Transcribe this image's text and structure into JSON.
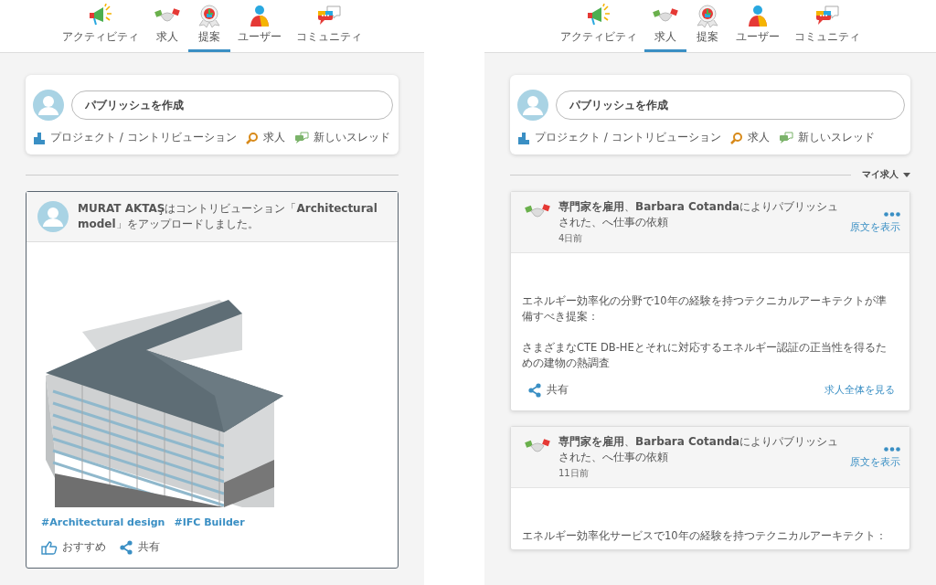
{
  "screens": [
    {
      "tabs": [
        {
          "label": "アクティビティ",
          "selected": false,
          "kind": "activity"
        },
        {
          "label": "求人",
          "selected": false,
          "kind": "jobs"
        },
        {
          "label": "提案",
          "selected": true,
          "kind": "proposals"
        },
        {
          "label": "ユーザー",
          "selected": false,
          "kind": "users"
        },
        {
          "label": "コミュニティ",
          "selected": false,
          "kind": "community"
        }
      ],
      "composer": {
        "placeholder": "パブリッシュを作成",
        "actions": [
          {
            "label": "プロジェクト / コントリビューション",
            "kind": "project"
          },
          {
            "label": "求人",
            "kind": "job"
          },
          {
            "label": "新しいスレッド",
            "kind": "thread"
          }
        ]
      },
      "feed": {
        "kind": "posts",
        "posts": [
          {
            "message": "**MURAT AKTAŞ**はコントリビューション「**Architectural model**」をアップロードしました。",
            "tags": [
              "#Architectural design",
              "#IFC Builder"
            ],
            "actions": [
              {
                "label": "おすすめ",
                "kind": "like"
              },
              {
                "label": "共有",
                "kind": "share"
              }
            ]
          }
        ]
      }
    },
    {
      "tabs": [
        {
          "label": "アクティビティ",
          "selected": false,
          "kind": "activity"
        },
        {
          "label": "求人",
          "selected": true,
          "kind": "jobs"
        },
        {
          "label": "提案",
          "selected": false,
          "kind": "proposals"
        },
        {
          "label": "ユーザー",
          "selected": false,
          "kind": "users"
        },
        {
          "label": "コミュニティ",
          "selected": false,
          "kind": "community"
        }
      ],
      "composer": {
        "placeholder": "パブリッシュを作成",
        "actions": [
          {
            "label": "プロジェクト / コントリビューション",
            "kind": "project"
          },
          {
            "label": "求人",
            "kind": "job"
          },
          {
            "label": "新しいスレッド",
            "kind": "thread"
          }
        ]
      },
      "feed": {
        "kind": "jobs",
        "filter": "マイ求人",
        "jobs": [
          {
            "title": "**専門家を雇用**、**Barbara Cotanda**によりパブリッシュされた、へ仕事の依頼",
            "time": "4日前",
            "original_link": "原文を表示",
            "paragraphs": [
              "エネルギー効率化の分野で10年の経験を持つテクニカルアーキテクトが準備すべき提案：",
              "さまざまなCTE DB-HEとそれに対応するエネルギー認証の正当性を得るための建物の熱調査"
            ],
            "share": "共有",
            "view_link": "求人全体を見る"
          },
          {
            "title": "**専門家を雇用**、**Barbara Cotanda**によりパブリッシュされた、へ仕事の依頼",
            "time": "11日前",
            "original_link": "原文を表示",
            "paragraphs": [
              "エネルギー効率化サービスで10年の経験を持つテクニカルアーキテクト："
            ]
          }
        ]
      }
    }
  ]
}
